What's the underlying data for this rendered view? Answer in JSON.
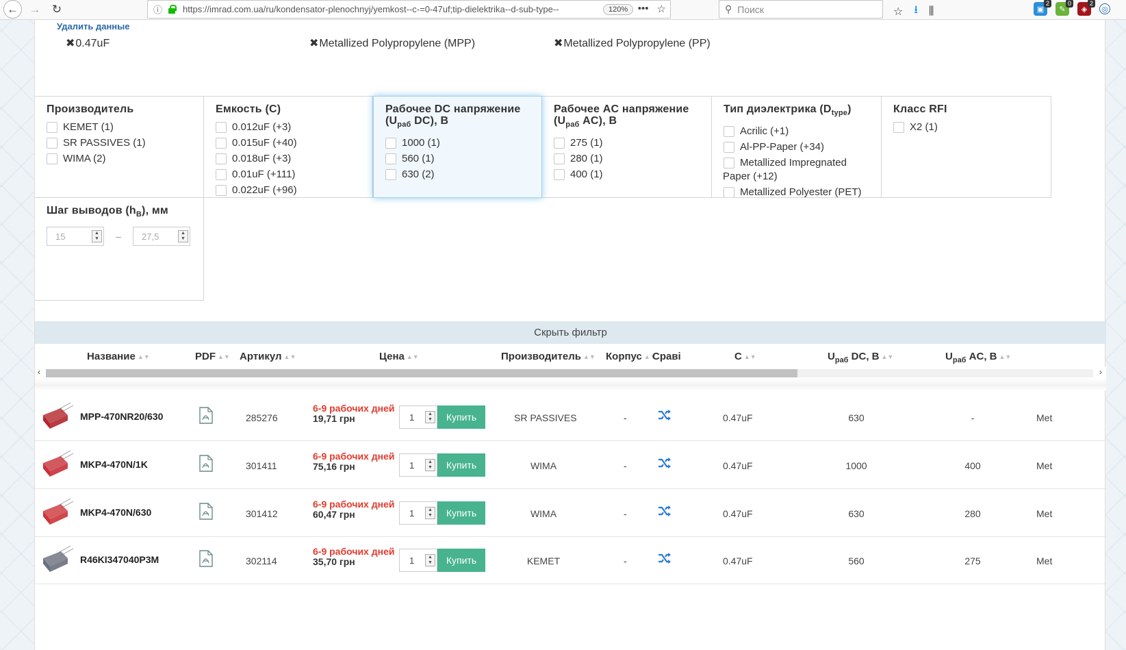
{
  "browser": {
    "url": "https://imrad.com.ua/ru/kondensator-plenochnyj/yemkost--c-=0-47uf;tip-dielektrika--d-sub-type--",
    "zoom": "120%",
    "search_placeholder": "Поиск",
    "ext_badges": [
      "2",
      "0",
      "2"
    ]
  },
  "filters": {
    "remove_label": "Удалить данные",
    "chips": [
      "0.47uF",
      "Metallized Polypropylene (MPP)",
      "Metallized Polypropylene (PP)"
    ]
  },
  "filter_groups": {
    "manufacturer": {
      "title": "Производитель",
      "options": [
        "KEMET (1)",
        "SR PASSIVES (1)",
        "WIMA (2)"
      ]
    },
    "capacity": {
      "title": "Емкость (C)",
      "options": [
        "0.012uF (+3)",
        "0.015uF (+40)",
        "0.018uF (+3)",
        "0.01uF (+111)",
        "0.022uF (+96)"
      ]
    },
    "dc_voltage": {
      "title": "Рабочее DC напряжение",
      "title_line2_pre": "(U",
      "title_line2_sub": "раб",
      "title_line2_post": " DC), В",
      "options": [
        "1000 (1)",
        "560 (1)",
        "630 (2)"
      ]
    },
    "ac_voltage": {
      "title": "Рабочее AC напряжение",
      "title_line2_pre": "(U",
      "title_line2_sub": "раб",
      "title_line2_post": " AC), В",
      "options": [
        "275 (1)",
        "280 (1)",
        "400 (1)"
      ]
    },
    "dielectric": {
      "title_pre": "Тип диэлектрика (D",
      "title_sub": "type",
      "title_post": ")",
      "options": [
        "Acrilic (+1)",
        "Al-PP-Paper (+34)",
        "Metallized Impregnated",
        "Paper (+12)",
        "Metallized Polyester (PET)"
      ]
    },
    "rfi": {
      "title": "Класс RFI",
      "options": [
        "X2 (1)"
      ]
    },
    "pitch": {
      "title_pre": "Шаг выводов (h",
      "title_sub": "B",
      "title_post": "), мм",
      "min": "15",
      "max": "27,5",
      "dash": "–"
    }
  },
  "hide_filter_label": "Скрыть фильтр",
  "table": {
    "headers": {
      "name": "Название",
      "pdf": "PDF",
      "article": "Артикул",
      "price": "Цена",
      "maker": "Производитель",
      "case": "Корпус",
      "compare": "Сравi",
      "cap": "C",
      "udc_pre": "U",
      "udc_sub": "раб",
      "udc_post": " DC, В",
      "uac_pre": "U",
      "uac_sub": "раб",
      "uac_post": " AC, В"
    },
    "buy_label": "Купить",
    "rows": [
      {
        "name": "MPP-470NR20/630",
        "article": "285276",
        "stock": "6-9 рабочих дней",
        "price": "19,71 грн",
        "qty": "1",
        "maker": "SR PASSIVES",
        "case": "-",
        "cap": "0.47uF",
        "udc": "630",
        "uac": "-",
        "dtype": "Met",
        "color": "#b3262a"
      },
      {
        "name": "MKP4-470N/1K",
        "article": "301411",
        "stock": "6-9 рабочих дней",
        "price": "75,16 грн",
        "qty": "1",
        "maker": "WIMA",
        "case": "-",
        "cap": "0.47uF",
        "udc": "1000",
        "uac": "400",
        "dtype": "Met",
        "color": "#c8303a"
      },
      {
        "name": "MKP4-470N/630",
        "article": "301412",
        "stock": "6-9 рабочих дней",
        "price": "60,47 грн",
        "qty": "1",
        "maker": "WIMA",
        "case": "-",
        "cap": "0.47uF",
        "udc": "630",
        "uac": "280",
        "dtype": "Met",
        "color": "#cc3438"
      },
      {
        "name": "R46KI347040P3M",
        "article": "302114",
        "stock": "6-9 рабочих дней",
        "price": "35,70 грн",
        "qty": "1",
        "maker": "KEMET",
        "case": "-",
        "cap": "0.47uF",
        "udc": "560",
        "uac": "275",
        "dtype": "Met",
        "color": "#6a6e7c"
      }
    ]
  },
  "colors": {
    "accent_blue": "#2b6aa6",
    "buy_green": "#47b38f",
    "stock_red": "#e23b2e",
    "compare_blue": "#2a7ad8"
  }
}
